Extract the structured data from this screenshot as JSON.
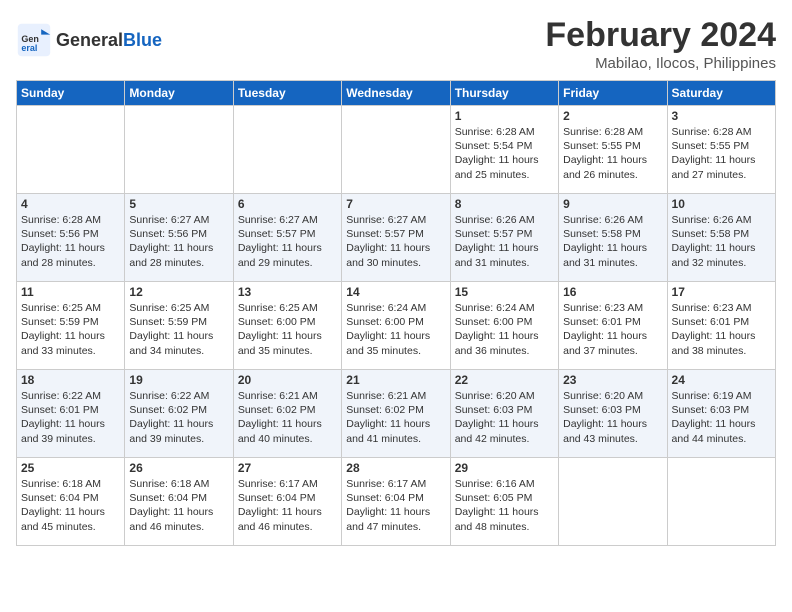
{
  "header": {
    "logo_general": "General",
    "logo_blue": "Blue",
    "title": "February 2024",
    "subtitle": "Mabilao, Ilocos, Philippines"
  },
  "days_of_week": [
    "Sunday",
    "Monday",
    "Tuesday",
    "Wednesday",
    "Thursday",
    "Friday",
    "Saturday"
  ],
  "weeks": [
    [
      {
        "day": "",
        "info": ""
      },
      {
        "day": "",
        "info": ""
      },
      {
        "day": "",
        "info": ""
      },
      {
        "day": "",
        "info": ""
      },
      {
        "day": "1",
        "info": "Sunrise: 6:28 AM\nSunset: 5:54 PM\nDaylight: 11 hours\nand 25 minutes."
      },
      {
        "day": "2",
        "info": "Sunrise: 6:28 AM\nSunset: 5:55 PM\nDaylight: 11 hours\nand 26 minutes."
      },
      {
        "day": "3",
        "info": "Sunrise: 6:28 AM\nSunset: 5:55 PM\nDaylight: 11 hours\nand 27 minutes."
      }
    ],
    [
      {
        "day": "4",
        "info": "Sunrise: 6:28 AM\nSunset: 5:56 PM\nDaylight: 11 hours\nand 28 minutes."
      },
      {
        "day": "5",
        "info": "Sunrise: 6:27 AM\nSunset: 5:56 PM\nDaylight: 11 hours\nand 28 minutes."
      },
      {
        "day": "6",
        "info": "Sunrise: 6:27 AM\nSunset: 5:57 PM\nDaylight: 11 hours\nand 29 minutes."
      },
      {
        "day": "7",
        "info": "Sunrise: 6:27 AM\nSunset: 5:57 PM\nDaylight: 11 hours\nand 30 minutes."
      },
      {
        "day": "8",
        "info": "Sunrise: 6:26 AM\nSunset: 5:57 PM\nDaylight: 11 hours\nand 31 minutes."
      },
      {
        "day": "9",
        "info": "Sunrise: 6:26 AM\nSunset: 5:58 PM\nDaylight: 11 hours\nand 31 minutes."
      },
      {
        "day": "10",
        "info": "Sunrise: 6:26 AM\nSunset: 5:58 PM\nDaylight: 11 hours\nand 32 minutes."
      }
    ],
    [
      {
        "day": "11",
        "info": "Sunrise: 6:25 AM\nSunset: 5:59 PM\nDaylight: 11 hours\nand 33 minutes."
      },
      {
        "day": "12",
        "info": "Sunrise: 6:25 AM\nSunset: 5:59 PM\nDaylight: 11 hours\nand 34 minutes."
      },
      {
        "day": "13",
        "info": "Sunrise: 6:25 AM\nSunset: 6:00 PM\nDaylight: 11 hours\nand 35 minutes."
      },
      {
        "day": "14",
        "info": "Sunrise: 6:24 AM\nSunset: 6:00 PM\nDaylight: 11 hours\nand 35 minutes."
      },
      {
        "day": "15",
        "info": "Sunrise: 6:24 AM\nSunset: 6:00 PM\nDaylight: 11 hours\nand 36 minutes."
      },
      {
        "day": "16",
        "info": "Sunrise: 6:23 AM\nSunset: 6:01 PM\nDaylight: 11 hours\nand 37 minutes."
      },
      {
        "day": "17",
        "info": "Sunrise: 6:23 AM\nSunset: 6:01 PM\nDaylight: 11 hours\nand 38 minutes."
      }
    ],
    [
      {
        "day": "18",
        "info": "Sunrise: 6:22 AM\nSunset: 6:01 PM\nDaylight: 11 hours\nand 39 minutes."
      },
      {
        "day": "19",
        "info": "Sunrise: 6:22 AM\nSunset: 6:02 PM\nDaylight: 11 hours\nand 39 minutes."
      },
      {
        "day": "20",
        "info": "Sunrise: 6:21 AM\nSunset: 6:02 PM\nDaylight: 11 hours\nand 40 minutes."
      },
      {
        "day": "21",
        "info": "Sunrise: 6:21 AM\nSunset: 6:02 PM\nDaylight: 11 hours\nand 41 minutes."
      },
      {
        "day": "22",
        "info": "Sunrise: 6:20 AM\nSunset: 6:03 PM\nDaylight: 11 hours\nand 42 minutes."
      },
      {
        "day": "23",
        "info": "Sunrise: 6:20 AM\nSunset: 6:03 PM\nDaylight: 11 hours\nand 43 minutes."
      },
      {
        "day": "24",
        "info": "Sunrise: 6:19 AM\nSunset: 6:03 PM\nDaylight: 11 hours\nand 44 minutes."
      }
    ],
    [
      {
        "day": "25",
        "info": "Sunrise: 6:18 AM\nSunset: 6:04 PM\nDaylight: 11 hours\nand 45 minutes."
      },
      {
        "day": "26",
        "info": "Sunrise: 6:18 AM\nSunset: 6:04 PM\nDaylight: 11 hours\nand 46 minutes."
      },
      {
        "day": "27",
        "info": "Sunrise: 6:17 AM\nSunset: 6:04 PM\nDaylight: 11 hours\nand 46 minutes."
      },
      {
        "day": "28",
        "info": "Sunrise: 6:17 AM\nSunset: 6:04 PM\nDaylight: 11 hours\nand 47 minutes."
      },
      {
        "day": "29",
        "info": "Sunrise: 6:16 AM\nSunset: 6:05 PM\nDaylight: 11 hours\nand 48 minutes."
      },
      {
        "day": "",
        "info": ""
      },
      {
        "day": "",
        "info": ""
      }
    ]
  ]
}
